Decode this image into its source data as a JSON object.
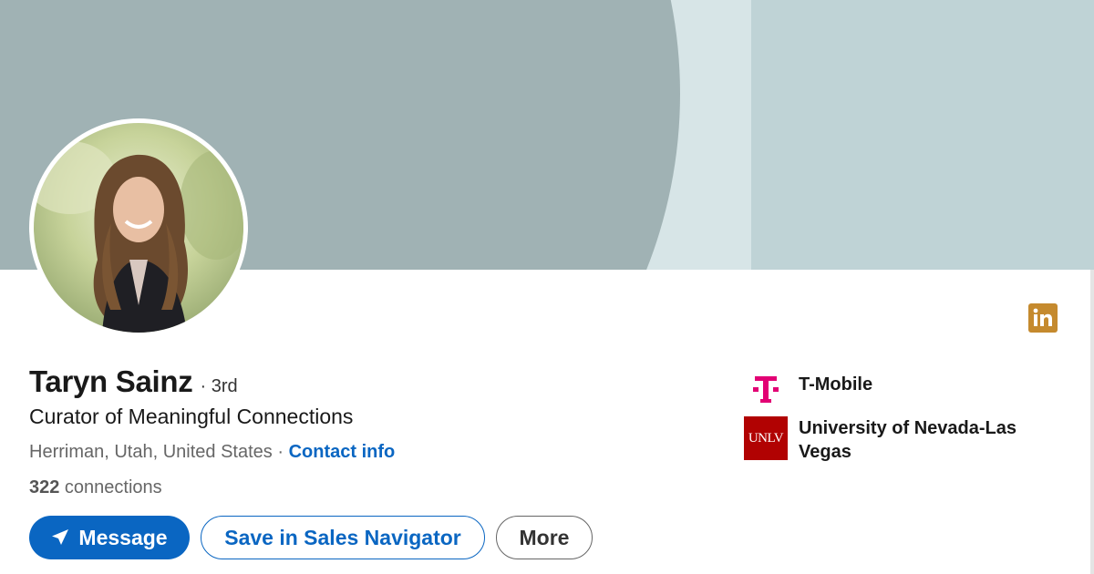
{
  "profile": {
    "name": "Taryn Sainz",
    "degree": "· 3rd",
    "headline": "Curator of Meaningful Connections",
    "location": "Herriman, Utah, United States",
    "location_separator": " · ",
    "contact_info_label": "Contact info",
    "connections_count": "322",
    "connections_label": " connections"
  },
  "actions": {
    "message_label": "Message",
    "save_label": "Save in Sales Navigator",
    "more_label": "More"
  },
  "organizations": [
    {
      "name": "T-Mobile",
      "logo_icon": "t-mobile-logo",
      "logo_color": "#e20074"
    },
    {
      "name": "University of Nevada-Las Vegas",
      "logo_icon": "unlv-logo",
      "logo_text": "UNLV",
      "logo_color": "#b10202"
    }
  ],
  "colors": {
    "primary": "#0a66c2",
    "banner_light": "#bfd3d6",
    "banner_dark": "#a0b2b4",
    "linkedin_badge": "#c58a2e"
  }
}
